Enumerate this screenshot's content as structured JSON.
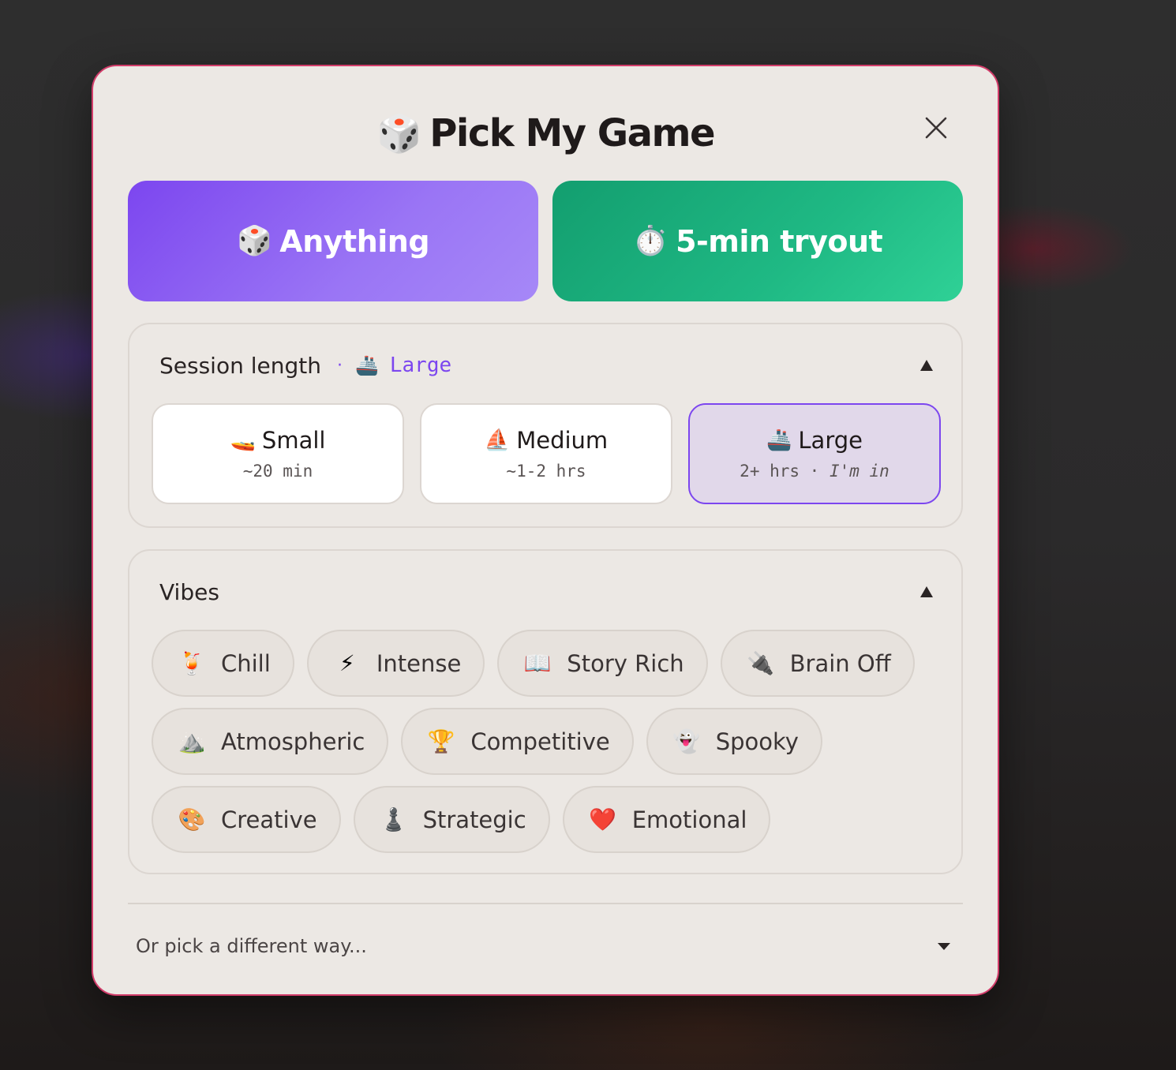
{
  "modal": {
    "title_icon": "🎲",
    "title": "Pick My Game",
    "close_icon": "close-icon"
  },
  "hero": {
    "anything": {
      "emoji": "🎲",
      "label": "Anything"
    },
    "tryout": {
      "emoji": "⏱️",
      "label": "5-min tryout"
    }
  },
  "session": {
    "title": "Session length",
    "dot": "·",
    "selected_emoji": "🚢",
    "selected_value": "Large",
    "options": [
      {
        "emoji": "🚤",
        "label": "Small",
        "sub": "~20 min",
        "sub_italic": ""
      },
      {
        "emoji": "⛵",
        "label": "Medium",
        "sub": "~1-2 hrs",
        "sub_italic": ""
      },
      {
        "emoji": "🚢",
        "label": "Large",
        "sub": "2+ hrs · ",
        "sub_italic": "I'm in"
      }
    ]
  },
  "vibes": {
    "title": "Vibes",
    "chips": [
      {
        "emoji": "🍹",
        "label": "Chill"
      },
      {
        "emoji": "⚡",
        "label": "Intense"
      },
      {
        "emoji": "📖",
        "label": "Story Rich"
      },
      {
        "emoji": "🔌",
        "label": "Brain Off"
      },
      {
        "emoji": "⛰️",
        "label": "Atmospheric"
      },
      {
        "emoji": "🏆",
        "label": "Competitive"
      },
      {
        "emoji": "👻",
        "label": "Spooky"
      },
      {
        "emoji": "🎨",
        "label": "Creative"
      },
      {
        "emoji": "♟️",
        "label": "Strategic"
      },
      {
        "emoji": "❤️",
        "label": "Emotional"
      }
    ]
  },
  "footer": {
    "alt_label": "Or pick a different way..."
  },
  "colors": {
    "accent_purple": "#7c46ef",
    "accent_green": "#1fb984",
    "modal_border": "#d23c6a",
    "modal_bg": "#ece8e4"
  }
}
